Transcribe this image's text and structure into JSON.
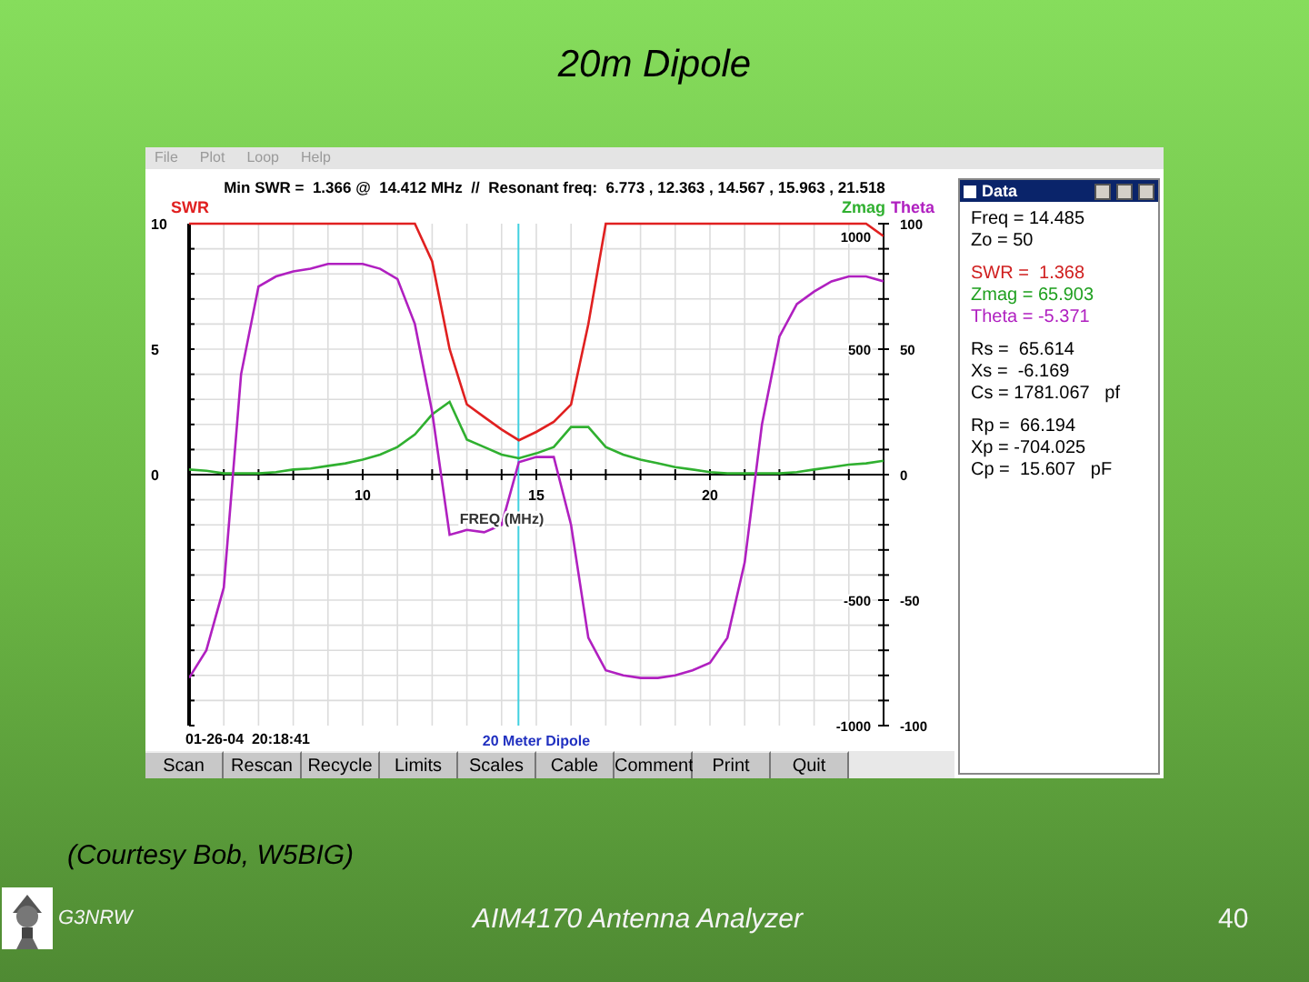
{
  "slide": {
    "title": "20m Dipole",
    "credit": "(Courtesy Bob, W5BIG)",
    "author": "G3NRW",
    "footer": "AIM4170 Antenna Analyzer",
    "page": "40"
  },
  "window": {
    "menu": [
      {
        "label": "File",
        "disabled": true
      },
      {
        "label": "Plot",
        "disabled": true
      },
      {
        "label": "Loop",
        "disabled": true
      },
      {
        "label": "Help",
        "disabled": true
      }
    ],
    "plot": {
      "summary": "Min SWR =  1.366 @  14.412 MHz  //  Resonant freq:  6.773 , 12.363 , 14.567 , 15.963 , 21.518",
      "left_axis_labels": [
        "10",
        "5",
        "0"
      ],
      "zmag_axis_labels": [
        "1000",
        "500",
        "-500",
        "-1000"
      ],
      "theta_axis_labels": [
        "100",
        "50",
        "0",
        "-50",
        "-100"
      ],
      "timestamp": "01-26-04  20:18:41",
      "caption": "20 Meter Dipole",
      "chart_data": {
        "type": "line",
        "xlabel": "FREQ (MHz)",
        "xlim": [
          5,
          25
        ],
        "ylim": [
          -10,
          10
        ],
        "xticks": [
          10,
          15,
          20
        ],
        "yticks": [
          0,
          5,
          10
        ],
        "x": [
          5,
          5.5,
          6,
          6.5,
          7,
          7.5,
          8,
          8.5,
          9,
          9.5,
          10,
          10.5,
          11,
          11.5,
          12,
          12.5,
          13,
          13.5,
          14,
          14.5,
          15,
          15.5,
          16,
          16.5,
          17,
          17.5,
          18,
          18.5,
          19,
          19.5,
          20,
          20.5,
          21,
          21.5,
          22,
          22.5,
          23,
          23.5,
          24,
          24.5,
          25
        ],
        "series": [
          {
            "name": "SWR",
            "color": "#e02020",
            "values": [
              10,
              10,
              10,
              10,
              10,
              10,
              10,
              10,
              10,
              10,
              10,
              10,
              10,
              10,
              8.5,
              5.0,
              2.8,
              2.3,
              1.8,
              1.37,
              1.7,
              2.1,
              2.8,
              6.0,
              10,
              10,
              10,
              10,
              10,
              10,
              10,
              10,
              10,
              10,
              10,
              10,
              10,
              10,
              10,
              10,
              9.5
            ]
          },
          {
            "name": "Zmag",
            "color": "#30b030",
            "values": [
              0.2,
              0.15,
              0.05,
              0.05,
              0.05,
              0.1,
              0.2,
              0.25,
              0.35,
              0.45,
              0.6,
              0.8,
              1.1,
              1.6,
              2.4,
              2.9,
              1.4,
              1.1,
              0.8,
              0.65,
              0.85,
              1.1,
              1.9,
              1.9,
              1.1,
              0.8,
              0.6,
              0.45,
              0.3,
              0.2,
              0.1,
              0.05,
              0.05,
              0.05,
              0.05,
              0.1,
              0.2,
              0.3,
              0.4,
              0.45,
              0.55
            ]
          },
          {
            "name": "Theta",
            "color": "#b020c0",
            "values": [
              -8.1,
              -7.0,
              -4.5,
              4.0,
              7.5,
              7.9,
              8.1,
              8.2,
              8.4,
              8.4,
              8.4,
              8.2,
              7.8,
              6.0,
              2.5,
              -2.4,
              -2.2,
              -2.3,
              -2.0,
              0.5,
              0.7,
              0.7,
              -2.0,
              -6.5,
              -7.8,
              -8.0,
              -8.1,
              -8.1,
              -8.0,
              -7.8,
              -7.5,
              -6.5,
              -3.5,
              2.0,
              5.5,
              6.8,
              7.3,
              7.7,
              7.9,
              7.9,
              7.7
            ]
          }
        ],
        "grid": true,
        "ref_lines": [
          {
            "axis": "x",
            "value": 14.485
          }
        ]
      }
    },
    "buttons": [
      "Scan",
      "Rescan",
      "Recycle",
      "Limits",
      "Scales",
      "Cable",
      "Comment",
      "Print",
      "Quit"
    ],
    "data_panel": {
      "title": "Data",
      "groups": [
        [
          {
            "text": "Freq = 14.485",
            "color": "#000000"
          },
          {
            "text": "Zo = 50",
            "color": "#000000"
          }
        ],
        [
          {
            "text": "SWR =  1.368",
            "color": "#d02020"
          },
          {
            "text": "Zmag = 65.903",
            "color": "#20a020"
          },
          {
            "text": "Theta = -5.371",
            "color": "#b020c0"
          }
        ],
        [
          {
            "text": "Rs =  65.614",
            "color": "#000000"
          },
          {
            "text": "Xs =  -6.169",
            "color": "#000000"
          },
          {
            "text": "Cs = 1781.067   pf",
            "color": "#000000"
          }
        ],
        [
          {
            "text": "Rp =  66.194",
            "color": "#000000"
          },
          {
            "text": "Xp = -704.025",
            "color": "#000000"
          },
          {
            "text": "Cp =  15.607   pF",
            "color": "#000000"
          }
        ]
      ]
    }
  }
}
